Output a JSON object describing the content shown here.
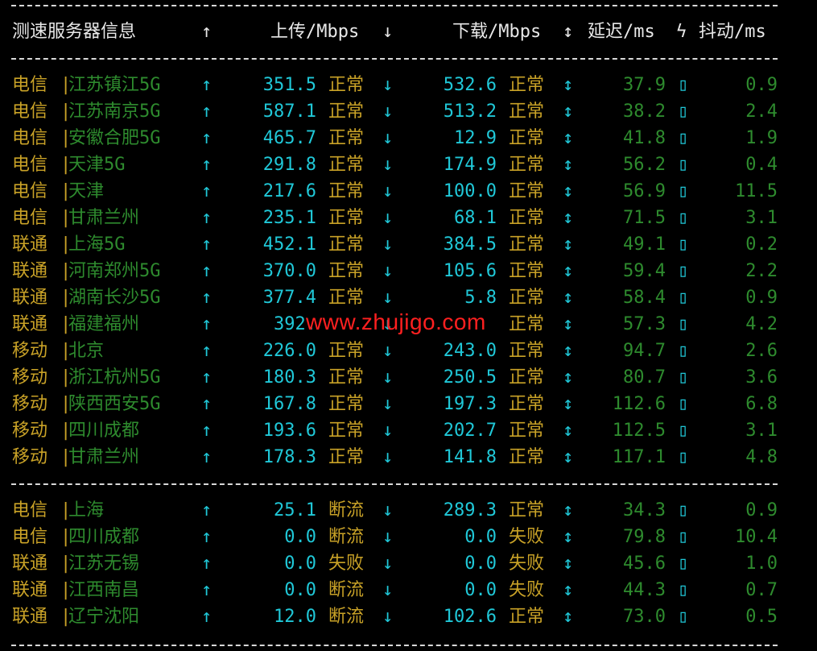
{
  "header": {
    "info": "测速服务器信息",
    "up_arrow": "↑",
    "upload": "上传/Mbps",
    "down_arrow": "↓",
    "download": "下载/Mbps",
    "updown_arrow": "↕",
    "latency": "延迟/ms",
    "bolt": "ϟ",
    "jitter": "抖动/ms"
  },
  "sep_char": "|",
  "box_char": "▯",
  "rows_main": [
    {
      "isp": "电信",
      "loc": "江苏镇江5G",
      "up": "351.5",
      "up_status": "正常",
      "down": "532.6",
      "down_status": "正常",
      "latency": "37.9",
      "jitter": "0.9"
    },
    {
      "isp": "电信",
      "loc": "江苏南京5G",
      "up": "587.1",
      "up_status": "正常",
      "down": "513.2",
      "down_status": "正常",
      "latency": "38.2",
      "jitter": "2.4"
    },
    {
      "isp": "电信",
      "loc": "安徽合肥5G",
      "up": "465.7",
      "up_status": "正常",
      "down": "12.9",
      "down_status": "正常",
      "latency": "41.8",
      "jitter": "1.9"
    },
    {
      "isp": "电信",
      "loc": "天津5G",
      "up": "291.8",
      "up_status": "正常",
      "down": "174.9",
      "down_status": "正常",
      "latency": "56.2",
      "jitter": "0.4"
    },
    {
      "isp": "电信",
      "loc": "天津",
      "up": "217.6",
      "up_status": "正常",
      "down": "100.0",
      "down_status": "正常",
      "latency": "56.9",
      "jitter": "11.5"
    },
    {
      "isp": "电信",
      "loc": "甘肃兰州",
      "up": "235.1",
      "up_status": "正常",
      "down": "68.1",
      "down_status": "正常",
      "latency": "71.5",
      "jitter": "3.1"
    },
    {
      "isp": "联通",
      "loc": "上海5G",
      "up": "452.1",
      "up_status": "正常",
      "down": "384.5",
      "down_status": "正常",
      "latency": "49.1",
      "jitter": "0.2"
    },
    {
      "isp": "联通",
      "loc": "河南郑州5G",
      "up": "370.0",
      "up_status": "正常",
      "down": "105.6",
      "down_status": "正常",
      "latency": "59.4",
      "jitter": "2.2"
    },
    {
      "isp": "联通",
      "loc": "湖南长沙5G",
      "up": "377.4",
      "up_status": "正常",
      "down": "5.8",
      "down_status": "正常",
      "latency": "58.4",
      "jitter": "0.9"
    },
    {
      "isp": "联通",
      "loc": "福建福州",
      "up": "392.",
      "up_status": "",
      "down": "",
      "down_status": "正常",
      "latency": "57.3",
      "jitter": "4.2"
    },
    {
      "isp": "移动",
      "loc": "北京",
      "up": "226.0",
      "up_status": "正常",
      "down": "243.0",
      "down_status": "正常",
      "latency": "94.7",
      "jitter": "2.6"
    },
    {
      "isp": "移动",
      "loc": "浙江杭州5G",
      "up": "180.3",
      "up_status": "正常",
      "down": "250.5",
      "down_status": "正常",
      "latency": "80.7",
      "jitter": "3.6"
    },
    {
      "isp": "移动",
      "loc": "陕西西安5G",
      "up": "167.8",
      "up_status": "正常",
      "down": "197.3",
      "down_status": "正常",
      "latency": "112.6",
      "jitter": "6.8"
    },
    {
      "isp": "移动",
      "loc": "四川成都",
      "up": "193.6",
      "up_status": "正常",
      "down": "202.7",
      "down_status": "正常",
      "latency": "112.5",
      "jitter": "3.1"
    },
    {
      "isp": "移动",
      "loc": "甘肃兰州",
      "up": "178.3",
      "up_status": "正常",
      "down": "141.8",
      "down_status": "正常",
      "latency": "117.1",
      "jitter": "4.8"
    }
  ],
  "rows_extra": [
    {
      "isp": "电信",
      "loc": "上海",
      "up": "25.1",
      "up_status": "断流",
      "down": "289.3",
      "down_status": "正常",
      "latency": "34.3",
      "jitter": "0.9"
    },
    {
      "isp": "电信",
      "loc": "四川成都",
      "up": "0.0",
      "up_status": "断流",
      "down": "0.0",
      "down_status": "失败",
      "latency": "79.8",
      "jitter": "10.4"
    },
    {
      "isp": "联通",
      "loc": "江苏无锡",
      "up": "0.0",
      "up_status": "失败",
      "down": "0.0",
      "down_status": "失败",
      "latency": "45.6",
      "jitter": "1.0"
    },
    {
      "isp": "联通",
      "loc": "江西南昌",
      "up": "0.0",
      "up_status": "断流",
      "down": "0.0",
      "down_status": "失败",
      "latency": "44.3",
      "jitter": "0.7"
    },
    {
      "isp": "联通",
      "loc": "辽宁沈阳",
      "up": "12.0",
      "up_status": "断流",
      "down": "102.6",
      "down_status": "正常",
      "latency": "73.0",
      "jitter": "0.5"
    }
  ],
  "watermark": "www.zhujigo.com"
}
